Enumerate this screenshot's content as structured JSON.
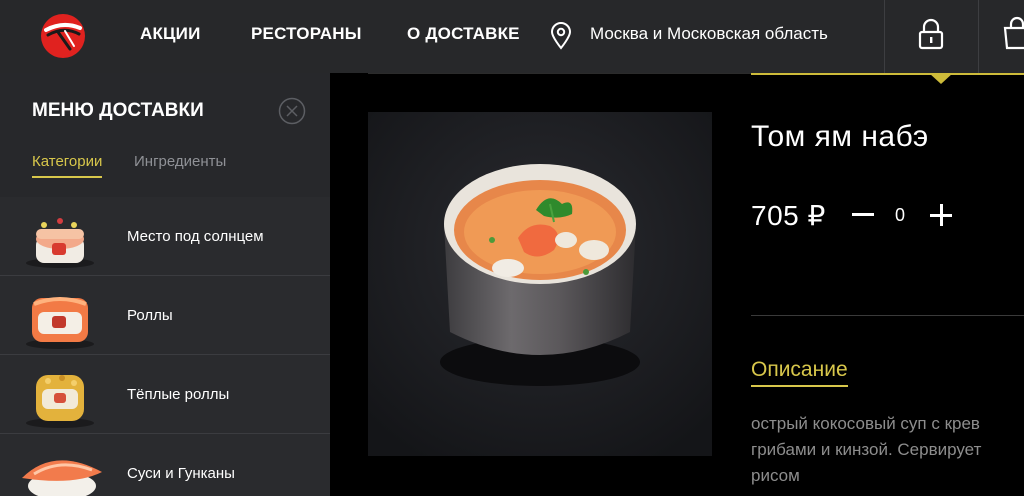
{
  "header": {
    "nav": [
      "АКЦИИ",
      "РЕСТОРАНЫ",
      "О ДОСТАВКЕ"
    ],
    "region": "Москва и Московская область"
  },
  "sidebar": {
    "title": "МЕНЮ ДОСТАВКИ",
    "tabs": [
      "Категории",
      "Ингредиенты"
    ],
    "items": [
      {
        "label": "Место под солнцем"
      },
      {
        "label": "Роллы"
      },
      {
        "label": "Тёплые роллы"
      },
      {
        "label": "Суси и Гунканы"
      }
    ]
  },
  "product": {
    "title": "Том ям набэ",
    "price": "705 ₽",
    "quantity": "0",
    "description_title": "Описание",
    "description_lines": [
      "острый кокосовый суп с крев",
      "грибами и кинзой. Сервирует",
      "рисом"
    ]
  },
  "colors": {
    "accent": "#d8c74b",
    "header_bg": "#27282a",
    "sidebar_bg": "#2a2b2e",
    "logo_red": "#e0221f"
  },
  "icons": [
    "logo-icon",
    "location-pin-icon",
    "lock-icon",
    "shopping-bag-icon",
    "close-icon"
  ]
}
